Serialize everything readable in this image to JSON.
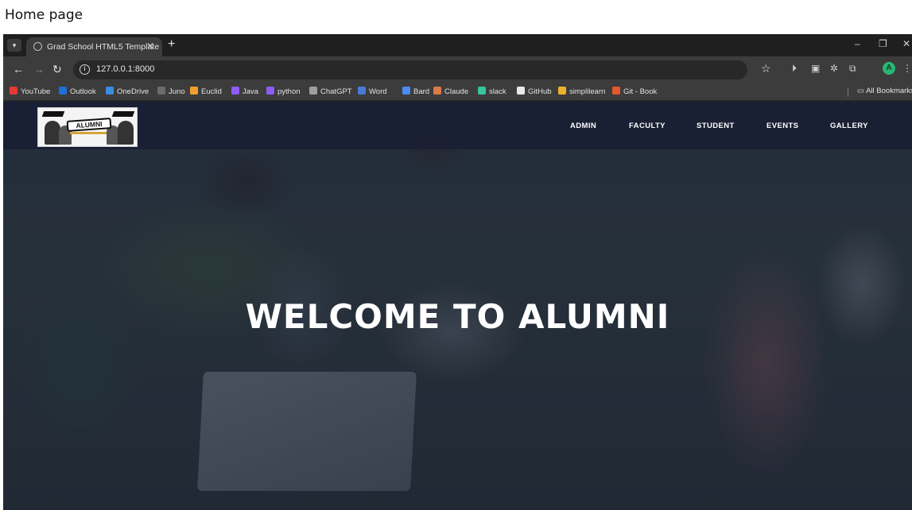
{
  "caption": "Home page",
  "browser": {
    "tab_title": "Grad School HTML5 Template",
    "url": "127.0.0.1:8000",
    "profile_initial": "A",
    "bookmarks": [
      {
        "label": "YouTube",
        "color": "#e53935"
      },
      {
        "label": "Outlook",
        "color": "#1e6fd6"
      },
      {
        "label": "OneDrive",
        "color": "#3a8de0"
      },
      {
        "label": "Juno",
        "color": "#6b6b6b"
      },
      {
        "label": "Euclid",
        "color": "#f0a030"
      },
      {
        "label": "Java",
        "color": "#8d5cf6"
      },
      {
        "label": "python",
        "color": "#8d5cf6"
      },
      {
        "label": "ChatGPT",
        "color": "#9e9e9e"
      },
      {
        "label": "Word",
        "color": "#4a7ad8"
      },
      {
        "label": "Bard",
        "color": "#4a8cf0"
      },
      {
        "label": "Claude",
        "color": "#d97a4a"
      },
      {
        "label": "slack",
        "color": "#36c5a0"
      },
      {
        "label": "GitHub",
        "color": "#e8e8e8"
      },
      {
        "label": "simplilearn",
        "color": "#f0b030"
      },
      {
        "label": "Git - Book",
        "color": "#e4562b"
      }
    ],
    "all_bookmarks": "All Bookmarks"
  },
  "site": {
    "logo_text": "ALUMNI",
    "nav": [
      "ADMIN",
      "FACULTY",
      "STUDENT",
      "EVENTS",
      "GALLERY"
    ],
    "hero_title": "WELCOME TO ALUMNI"
  }
}
